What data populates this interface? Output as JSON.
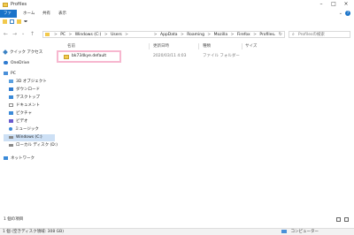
{
  "window": {
    "title": "Profiles"
  },
  "ribbon": {
    "tabs": [
      "ファイル",
      "ホーム",
      "共有",
      "表示"
    ],
    "help": "?",
    "caret": "⌄"
  },
  "nav_buttons": {
    "back": "←",
    "forward": "→",
    "recent": "⌄",
    "up": "↑"
  },
  "address": {
    "crumbs": [
      "PC",
      "Windows (C:)",
      "Users",
      "",
      "AppData",
      "Roaming",
      "Mozilla",
      "Firefox",
      "Profiles"
    ],
    "separator": ">",
    "dropdown": "⌄",
    "refresh": "↻"
  },
  "search": {
    "placeholder": "Profilesの検索",
    "icon": "⌕"
  },
  "sidebar": {
    "items": [
      {
        "label": "クイック アクセス",
        "icon": "star-icon",
        "color": "#3b82c4"
      },
      {
        "label": "OneDrive",
        "icon": "cloud-icon",
        "color": "#2f7bd0"
      },
      {
        "label": "PC",
        "icon": "pc-icon",
        "color": "#4a90d9"
      },
      {
        "label": "3D オブジェクト",
        "icon": "cube-icon",
        "color": "#5aa0e0"
      },
      {
        "label": "ダウンロード",
        "icon": "download-icon",
        "color": "#2f7bd0"
      },
      {
        "label": "デスクトップ",
        "icon": "desktop-icon",
        "color": "#3b8ad8"
      },
      {
        "label": "ドキュメント",
        "icon": "document-icon",
        "color": "#8a8a8a"
      },
      {
        "label": "ピクチャ",
        "icon": "pictures-icon",
        "color": "#3b8ad8"
      },
      {
        "label": "ビデオ",
        "icon": "video-icon",
        "color": "#6a5acd"
      },
      {
        "label": "ミュージック",
        "icon": "music-icon",
        "color": "#3b8ad8"
      },
      {
        "label": "Windows (C:)",
        "icon": "drive-icon",
        "color": "#888888"
      },
      {
        "label": "ローカル ディスク (D:)",
        "icon": "drive-icon",
        "color": "#888888"
      },
      {
        "label": "ネットワーク",
        "icon": "network-icon",
        "color": "#3b8ad8"
      }
    ]
  },
  "columns": {
    "name": "名前",
    "date": "更新日時",
    "type": "種類",
    "size": "サイズ"
  },
  "files": [
    {
      "name": "bk734kye.default",
      "date": "2020/03/11 4:03",
      "type": "ファイル フォルダー",
      "size": ""
    }
  ],
  "status": {
    "item_count": "1 個の項目",
    "bottom_left": "1 個 (空きディスク領域: 308 GB)",
    "bottom_right": "コンピューター"
  },
  "colors": {
    "accent": "#1a73c9",
    "selection_border": "#f7b7cf",
    "folder": "#f2c94c"
  }
}
